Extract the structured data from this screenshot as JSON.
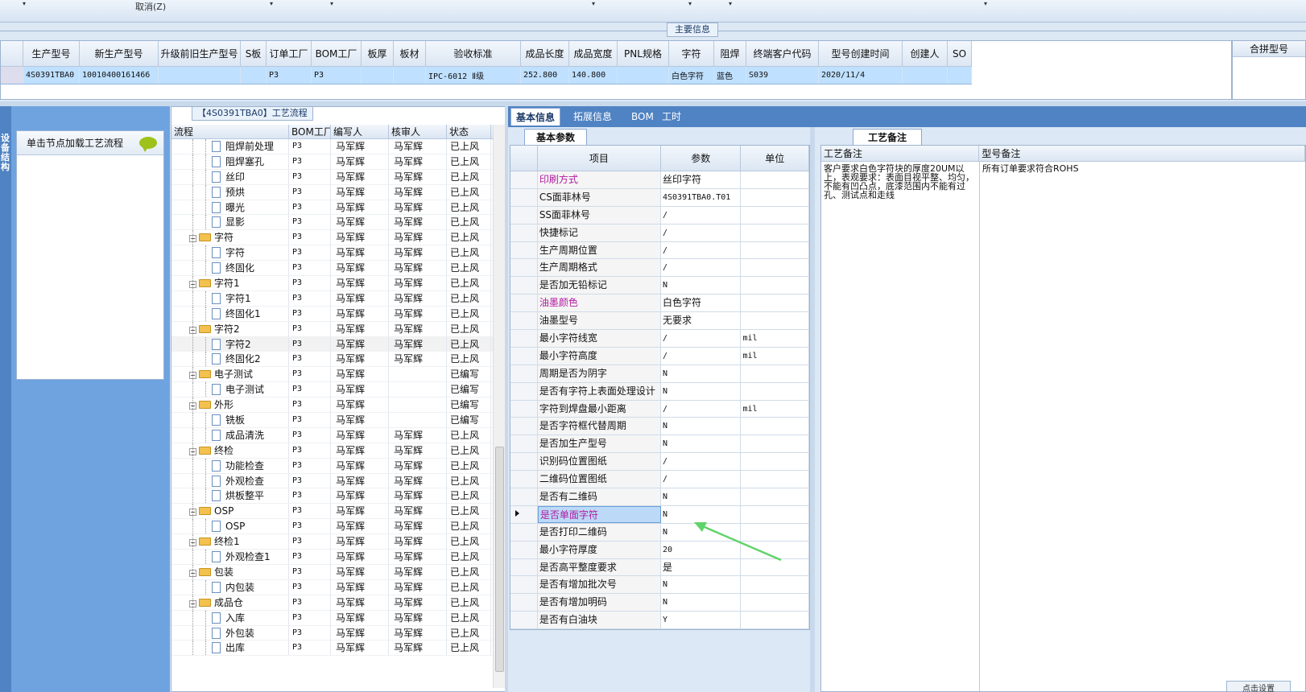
{
  "topbar": {
    "cancel_label": "取消(Z)"
  },
  "main_info_label": "主要信息",
  "product_grid": {
    "headers": [
      "生产型号",
      "新生产型号",
      "升级前旧生产型号",
      "S板",
      "订单工厂",
      "BOM工厂",
      "板厚",
      "板材",
      "验收标准",
      "成品长度",
      "成品宽度",
      "PNL规格",
      "字符",
      "阻焊",
      "终端客户代码",
      "型号创建时间",
      "创建人",
      "SO"
    ],
    "row": [
      "4S0391TBA0",
      "10010400161466",
      "",
      "",
      "P3",
      "P3",
      "",
      "",
      "IPC-6012 Ⅱ级",
      "252.800",
      "140.800",
      "",
      "白色字符",
      "蓝色",
      "S039",
      "2020/11/4",
      "",
      ""
    ]
  },
  "merge_header": "合拼型号",
  "left_strip_label": "设备结构",
  "node_panel": {
    "header": "单击节点加载工艺流程"
  },
  "process_panel": {
    "title": "【4S0391TBA0】工艺流程",
    "headers": [
      "流程",
      "BOM工厂",
      "编写人",
      "核审人",
      "状态"
    ],
    "rows": [
      {
        "name": "阻焊前处理",
        "bom": "P3",
        "writer": "马军辉",
        "reviewer": "马军辉",
        "status": "已上风",
        "level": 2
      },
      {
        "name": "阻焊塞孔",
        "bom": "P3",
        "writer": "马军辉",
        "reviewer": "马军辉",
        "status": "已上风",
        "level": 2
      },
      {
        "name": "丝印",
        "bom": "P3",
        "writer": "马军辉",
        "reviewer": "马军辉",
        "status": "已上风",
        "level": 2
      },
      {
        "name": "预烘",
        "bom": "P3",
        "writer": "马军辉",
        "reviewer": "马军辉",
        "status": "已上风",
        "level": 2
      },
      {
        "name": "曝光",
        "bom": "P3",
        "writer": "马军辉",
        "reviewer": "马军辉",
        "status": "已上风",
        "level": 2
      },
      {
        "name": "显影",
        "bom": "P3",
        "writer": "马军辉",
        "reviewer": "马军辉",
        "status": "已上风",
        "level": 2
      },
      {
        "name": "字符",
        "bom": "P3",
        "writer": "马军辉",
        "reviewer": "马军辉",
        "status": "已上风",
        "level": 1
      },
      {
        "name": "字符",
        "bom": "P3",
        "writer": "马军辉",
        "reviewer": "马军辉",
        "status": "已上风",
        "level": 2
      },
      {
        "name": "终固化",
        "bom": "P3",
        "writer": "马军辉",
        "reviewer": "马军辉",
        "status": "已上风",
        "level": 2
      },
      {
        "name": "字符1",
        "bom": "P3",
        "writer": "马军辉",
        "reviewer": "马军辉",
        "status": "已上风",
        "level": 1
      },
      {
        "name": "字符1",
        "bom": "P3",
        "writer": "马军辉",
        "reviewer": "马军辉",
        "status": "已上风",
        "level": 2
      },
      {
        "name": "终固化1",
        "bom": "P3",
        "writer": "马军辉",
        "reviewer": "马军辉",
        "status": "已上风",
        "level": 2
      },
      {
        "name": "字符2",
        "bom": "P3",
        "writer": "马军辉",
        "reviewer": "马军辉",
        "status": "已上风",
        "level": 1
      },
      {
        "name": "字符2",
        "bom": "P3",
        "writer": "马军辉",
        "reviewer": "马军辉",
        "status": "已上风",
        "level": 2,
        "selected": true
      },
      {
        "name": "终固化2",
        "bom": "P3",
        "writer": "马军辉",
        "reviewer": "马军辉",
        "status": "已上风",
        "level": 2
      },
      {
        "name": "电子测试",
        "bom": "P3",
        "writer": "马军辉",
        "reviewer": "",
        "status": "已编写",
        "level": 1
      },
      {
        "name": "电子测试",
        "bom": "P3",
        "writer": "马军辉",
        "reviewer": "",
        "status": "已编写",
        "level": 2
      },
      {
        "name": "外形",
        "bom": "P3",
        "writer": "马军辉",
        "reviewer": "",
        "status": "已编写",
        "level": 1
      },
      {
        "name": "铣板",
        "bom": "P3",
        "writer": "马军辉",
        "reviewer": "",
        "status": "已编写",
        "level": 2
      },
      {
        "name": "成品清洗",
        "bom": "P3",
        "writer": "马军辉",
        "reviewer": "马军辉",
        "status": "已上风",
        "level": 2
      },
      {
        "name": "终检",
        "bom": "P3",
        "writer": "马军辉",
        "reviewer": "马军辉",
        "status": "已上风",
        "level": 1
      },
      {
        "name": "功能检查",
        "bom": "P3",
        "writer": "马军辉",
        "reviewer": "马军辉",
        "status": "已上风",
        "level": 2
      },
      {
        "name": "外观检查",
        "bom": "P3",
        "writer": "马军辉",
        "reviewer": "马军辉",
        "status": "已上风",
        "level": 2
      },
      {
        "name": "烘板整平",
        "bom": "P3",
        "writer": "马军辉",
        "reviewer": "马军辉",
        "status": "已上风",
        "level": 2
      },
      {
        "name": "OSP",
        "bom": "P3",
        "writer": "马军辉",
        "reviewer": "马军辉",
        "status": "已上风",
        "level": 1
      },
      {
        "name": "OSP",
        "bom": "P3",
        "writer": "马军辉",
        "reviewer": "马军辉",
        "status": "已上风",
        "level": 2
      },
      {
        "name": "终检1",
        "bom": "P3",
        "writer": "马军辉",
        "reviewer": "马军辉",
        "status": "已上风",
        "level": 1
      },
      {
        "name": "外观检查1",
        "bom": "P3",
        "writer": "马军辉",
        "reviewer": "马军辉",
        "status": "已上风",
        "level": 2
      },
      {
        "name": "包装",
        "bom": "P3",
        "writer": "马军辉",
        "reviewer": "马军辉",
        "status": "已上风",
        "level": 1
      },
      {
        "name": "内包装",
        "bom": "P3",
        "writer": "马军辉",
        "reviewer": "马军辉",
        "status": "已上风",
        "level": 2
      },
      {
        "name": "成品仓",
        "bom": "P3",
        "writer": "马军辉",
        "reviewer": "马军辉",
        "status": "已上风",
        "level": 1
      },
      {
        "name": "入库",
        "bom": "P3",
        "writer": "马军辉",
        "reviewer": "马军辉",
        "status": "已上风",
        "level": 2
      },
      {
        "name": "外包装",
        "bom": "P3",
        "writer": "马军辉",
        "reviewer": "马军辉",
        "status": "已上风",
        "level": 2
      },
      {
        "name": "出库",
        "bom": "P3",
        "writer": "马军辉",
        "reviewer": "马军辉",
        "status": "已上风",
        "level": 2
      }
    ]
  },
  "right_tabs": [
    "基本信息",
    "拓展信息",
    "BOM",
    "工时"
  ],
  "basic_params": {
    "tab_label": "基本参数",
    "headers": [
      "项目",
      "参数",
      "单位"
    ],
    "rows": [
      {
        "item": "印刷方式",
        "value": "丝印字符",
        "unit": "",
        "pink": true
      },
      {
        "item": "CS面菲林号",
        "value": "4S0391TBA0.T01",
        "unit": ""
      },
      {
        "item": "SS面菲林号",
        "value": "/",
        "unit": ""
      },
      {
        "item": "快捷标记",
        "value": "/",
        "unit": ""
      },
      {
        "item": "生产周期位置",
        "value": "/",
        "unit": ""
      },
      {
        "item": "生产周期格式",
        "value": "/",
        "unit": ""
      },
      {
        "item": "是否加无铅标记",
        "value": "N",
        "unit": ""
      },
      {
        "item": "油墨颜色",
        "value": "白色字符",
        "unit": "",
        "pink": true
      },
      {
        "item": "油墨型号",
        "value": "无要求",
        "unit": ""
      },
      {
        "item": "最小字符线宽",
        "value": "/",
        "unit": "mil"
      },
      {
        "item": "最小字符高度",
        "value": "/",
        "unit": "mil"
      },
      {
        "item": "周期是否为阴字",
        "value": "N",
        "unit": ""
      },
      {
        "item": "是否有字符上表面处理设计",
        "value": "N",
        "unit": ""
      },
      {
        "item": "字符到焊盘最小距离",
        "value": "/",
        "unit": "mil"
      },
      {
        "item": "是否字符框代替周期",
        "value": "N",
        "unit": ""
      },
      {
        "item": "是否加生产型号",
        "value": "N",
        "unit": ""
      },
      {
        "item": "识别码位置图纸",
        "value": "/",
        "unit": ""
      },
      {
        "item": "二维码位置图纸",
        "value": "/",
        "unit": ""
      },
      {
        "item": "是否有二维码",
        "value": "N",
        "unit": ""
      },
      {
        "item": "是否单面字符",
        "value": "N",
        "unit": "",
        "pink": true,
        "selected": true
      },
      {
        "item": "是否打印二维码",
        "value": "N",
        "unit": ""
      },
      {
        "item": "最小字符厚度",
        "value": "20",
        "unit": ""
      },
      {
        "item": "是否高平整度要求",
        "value": "是",
        "unit": ""
      },
      {
        "item": "是否有增加批次号",
        "value": "N",
        "unit": ""
      },
      {
        "item": "是否有增加明码",
        "value": "N",
        "unit": ""
      },
      {
        "item": "是否有白油块",
        "value": "Y",
        "unit": ""
      }
    ]
  },
  "remarks": {
    "tab_label": "工艺备注",
    "headers": [
      "工艺备注",
      "型号备注"
    ],
    "process_remark": "客户要求白色字符块的厚度20UM以上，表观要求：表面目视平整、均匀，不能有凹凸点，底漆范围内不能有过孔、测试点和走线",
    "model_remark": "所有订单要求符合ROHS"
  },
  "corner_button": "点击设置",
  "colors": {
    "accent_blue": "#4f83c3",
    "selection": "#bfe0ff",
    "pink_text": "#b21aa0",
    "arrow_green": "#5fd36a"
  }
}
